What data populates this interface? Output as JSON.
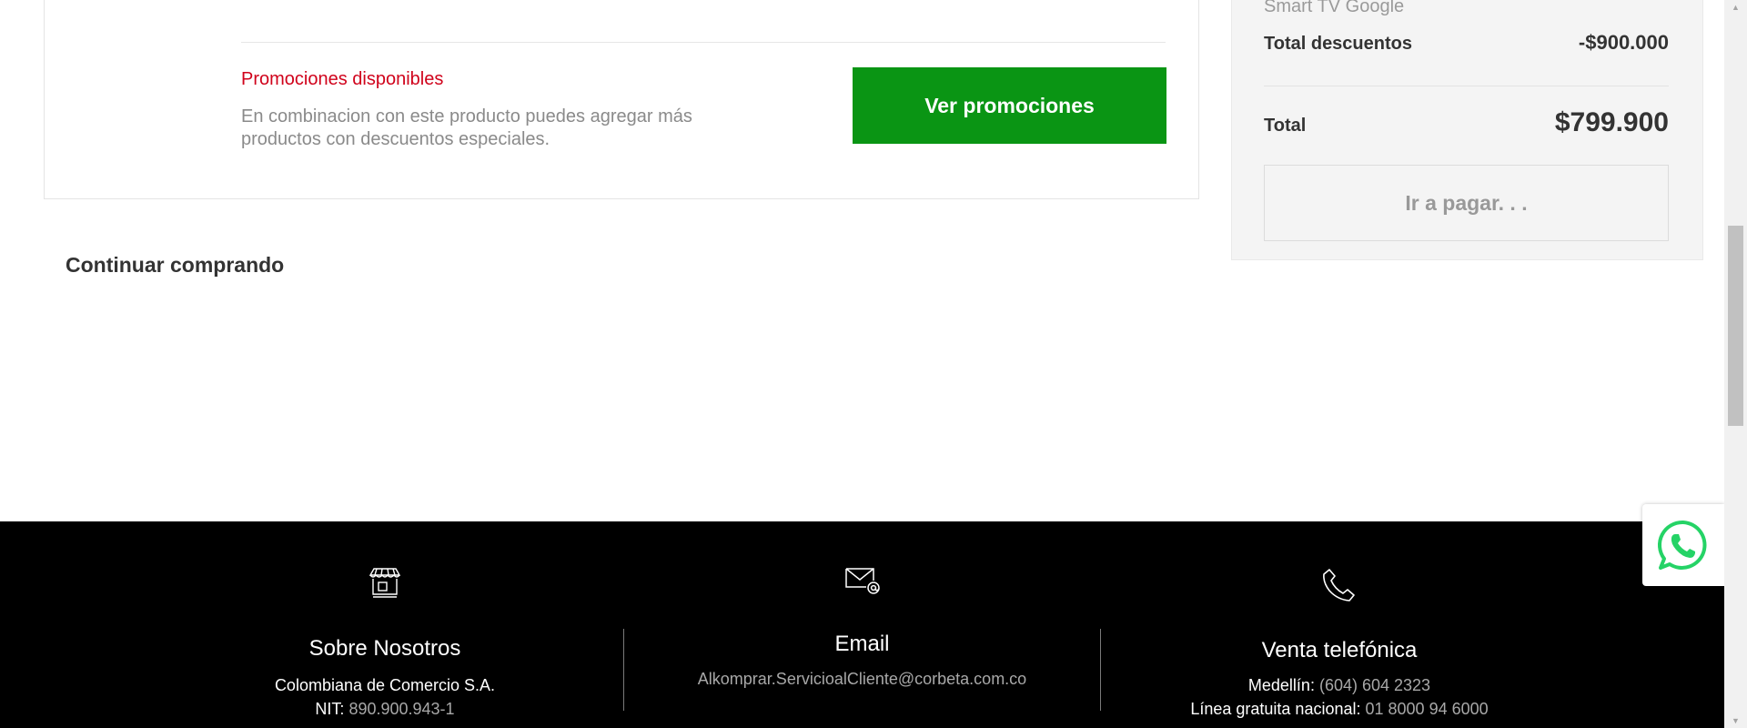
{
  "product_card": {
    "promo_title": "Promociones disponibles",
    "promo_description": "En combinacion con este producto puedes agregar más productos con descuentos especiales.",
    "promo_button_label": "Ver promociones"
  },
  "continue_shopping": {
    "heading": "Continuar comprando"
  },
  "summary": {
    "item_name": "Smart TV Google",
    "discount_label": "Total descuentos",
    "discount_value": "-$900.000",
    "total_label": "Total",
    "total_value": "$799.900",
    "pay_button_label": "Ir a pagar. . ."
  },
  "footer": {
    "about": {
      "icon": "store-icon",
      "title": "Sobre Nosotros",
      "company": "Colombiana de Comercio S.A.",
      "nit_label": "NIT:",
      "nit_value": "890.900.943-1"
    },
    "email": {
      "icon": "mail-at-icon",
      "title": "Email",
      "address": "Alkomprar.ServicioalCliente@corbeta.com.co"
    },
    "phone": {
      "icon": "phone-icon",
      "title": "Venta telefónica",
      "medellin_label": "Medellín:",
      "medellin_number": "(604) 604 2323",
      "national_label": "Línea gratuita nacional:",
      "national_number": "01 8000 94 6000"
    }
  },
  "whatsapp": {
    "icon": "whatsapp-icon"
  },
  "colors": {
    "promo_red": "#d0021b",
    "promo_green": "#0a9514",
    "footer_bg": "#000000",
    "whatsapp_green": "#25d366"
  }
}
